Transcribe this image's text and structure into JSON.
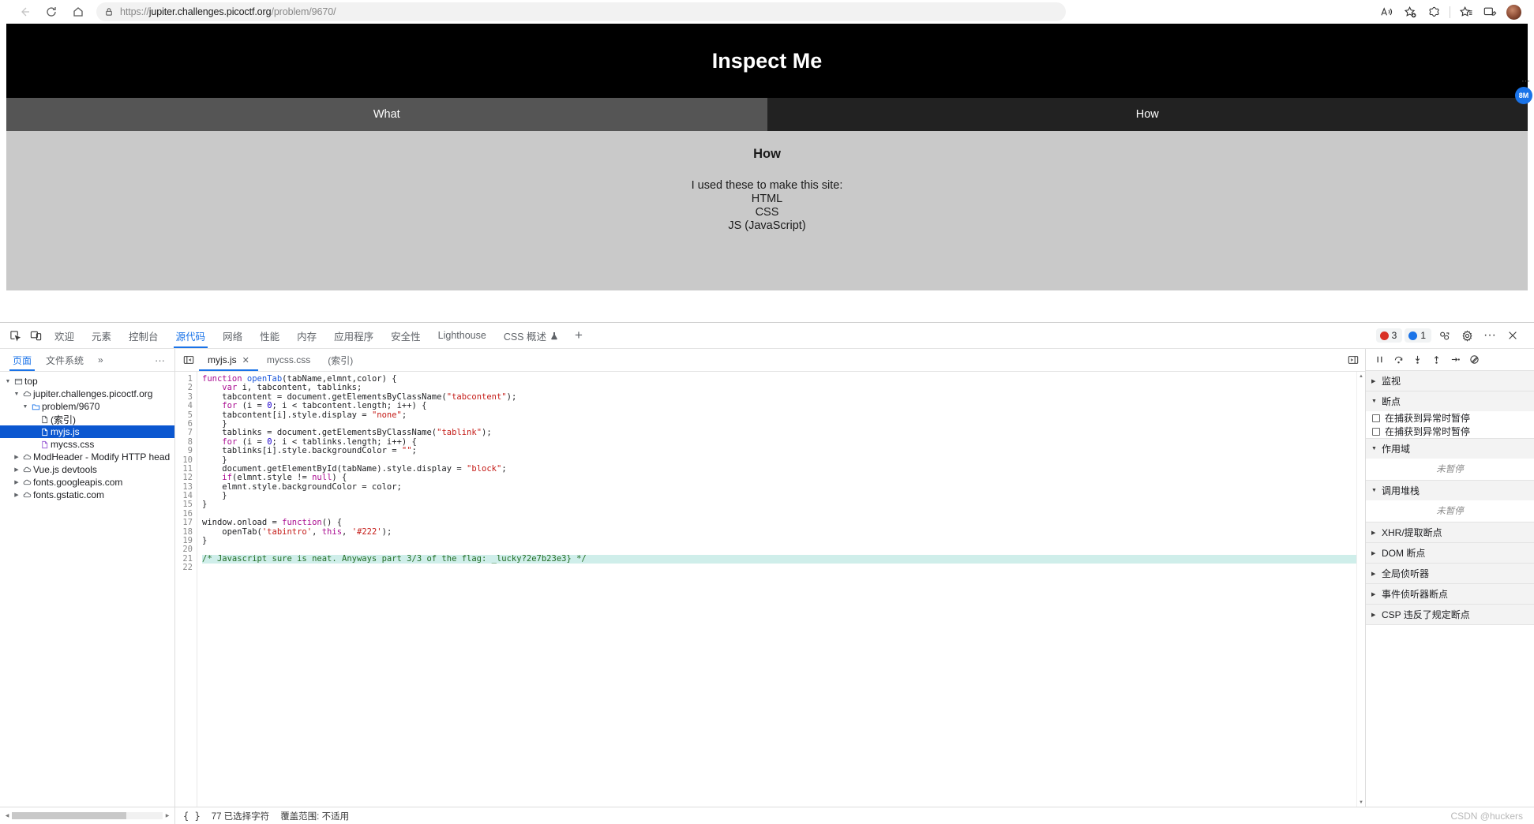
{
  "browser": {
    "back_label": "back-arrow",
    "reload_label": "reload",
    "home_label": "home",
    "url_scheme": "https://",
    "url_host": "jupiter.challenges.picoctf.org",
    "url_path": "/problem/9670/",
    "lock_icon": "lock-icon",
    "read_aloud_icon": "read-aloud-icon",
    "favorites_icon": "add-favorite-icon",
    "collections_icon": "collections-icon",
    "split_screen_icon": "split-screen-icon",
    "browser_essentials_icon": "browser-essentials-icon",
    "profile_icon": "profile-avatar"
  },
  "webpage": {
    "title": "Inspect Me",
    "tabs": [
      {
        "label": "What",
        "active": false
      },
      {
        "label": "How",
        "active": true
      }
    ],
    "heading": "How",
    "lines": [
      "I used these to make this site:",
      "HTML",
      "CSS",
      "JS (JavaScript)"
    ],
    "badge": "8M"
  },
  "devtools": {
    "panel_tabs": [
      {
        "label": "欢迎",
        "active": false
      },
      {
        "label": "元素",
        "active": false
      },
      {
        "label": "控制台",
        "active": false
      },
      {
        "label": "源代码",
        "active": true
      },
      {
        "label": "网络",
        "active": false
      },
      {
        "label": "性能",
        "active": false
      },
      {
        "label": "内存",
        "active": false
      },
      {
        "label": "应用程序",
        "active": false
      },
      {
        "label": "安全性",
        "active": false
      },
      {
        "label": "Lighthouse",
        "active": false
      },
      {
        "label": "CSS 概述",
        "active": false
      }
    ],
    "add_tab_label": "+",
    "error_count": "3",
    "message_count": "1",
    "navigator": {
      "tabs": [
        {
          "label": "页面",
          "active": true
        },
        {
          "label": "文件系统",
          "active": false
        }
      ],
      "more_tabs": "»",
      "more_menu": "···",
      "tree": [
        {
          "indent": 0,
          "twisty": "▼",
          "icon": "frame",
          "label": "top",
          "selected": false
        },
        {
          "indent": 1,
          "twisty": "▼",
          "icon": "cloud",
          "label": "jupiter.challenges.picoctf.org",
          "selected": false
        },
        {
          "indent": 2,
          "twisty": "▼",
          "icon": "folder",
          "label": "problem/9670",
          "selected": false
        },
        {
          "indent": 3,
          "twisty": "",
          "icon": "doc",
          "label": "(索引)",
          "selected": false
        },
        {
          "indent": 3,
          "twisty": "",
          "icon": "doc-js",
          "label": "myjs.js",
          "selected": true
        },
        {
          "indent": 3,
          "twisty": "",
          "icon": "doc-css",
          "label": "mycss.css",
          "selected": false
        },
        {
          "indent": 1,
          "twisty": "▶",
          "icon": "cloud",
          "label": "ModHeader - Modify HTTP head",
          "selected": false
        },
        {
          "indent": 1,
          "twisty": "▶",
          "icon": "cloud",
          "label": "Vue.js devtools",
          "selected": false
        },
        {
          "indent": 1,
          "twisty": "▶",
          "icon": "cloud",
          "label": "fonts.googleapis.com",
          "selected": false
        },
        {
          "indent": 1,
          "twisty": "▶",
          "icon": "cloud",
          "label": "fonts.gstatic.com",
          "selected": false
        }
      ]
    },
    "editor": {
      "tabs": [
        {
          "label": "myjs.js",
          "active": true,
          "closable": true
        },
        {
          "label": "mycss.css",
          "active": false,
          "closable": false
        },
        {
          "label": "(索引)",
          "active": false,
          "closable": false
        }
      ],
      "code_lines": [
        {
          "n": 1,
          "highlight": false,
          "tokens": [
            {
              "t": "function ",
              "c": "kw"
            },
            {
              "t": "openTab",
              "c": "fn"
            },
            {
              "t": "(tabName,elmnt,color) {",
              "c": "pln"
            }
          ]
        },
        {
          "n": 2,
          "highlight": false,
          "tokens": [
            {
              "t": "    ",
              "c": "pln"
            },
            {
              "t": "var",
              "c": "kw"
            },
            {
              "t": " i, tabcontent, tablinks;",
              "c": "pln"
            }
          ]
        },
        {
          "n": 3,
          "highlight": false,
          "tokens": [
            {
              "t": "    tabcontent = document.getElementsByClassName(",
              "c": "pln"
            },
            {
              "t": "\"tabcontent\"",
              "c": "str"
            },
            {
              "t": ");",
              "c": "pln"
            }
          ]
        },
        {
          "n": 4,
          "highlight": false,
          "tokens": [
            {
              "t": "    ",
              "c": "pln"
            },
            {
              "t": "for",
              "c": "kw"
            },
            {
              "t": " (i = ",
              "c": "pln"
            },
            {
              "t": "0",
              "c": "num"
            },
            {
              "t": "; i < tabcontent.length; i++) {",
              "c": "pln"
            }
          ]
        },
        {
          "n": 5,
          "highlight": false,
          "tokens": [
            {
              "t": "    tabcontent[i].style.display = ",
              "c": "pln"
            },
            {
              "t": "\"none\"",
              "c": "str"
            },
            {
              "t": ";",
              "c": "pln"
            }
          ]
        },
        {
          "n": 6,
          "highlight": false,
          "tokens": [
            {
              "t": "    }",
              "c": "pln"
            }
          ]
        },
        {
          "n": 7,
          "highlight": false,
          "tokens": [
            {
              "t": "    tablinks = document.getElementsByClassName(",
              "c": "pln"
            },
            {
              "t": "\"tablink\"",
              "c": "str"
            },
            {
              "t": ");",
              "c": "pln"
            }
          ]
        },
        {
          "n": 8,
          "highlight": false,
          "tokens": [
            {
              "t": "    ",
              "c": "pln"
            },
            {
              "t": "for",
              "c": "kw"
            },
            {
              "t": " (i = ",
              "c": "pln"
            },
            {
              "t": "0",
              "c": "num"
            },
            {
              "t": "; i < tablinks.length; i++) {",
              "c": "pln"
            }
          ]
        },
        {
          "n": 9,
          "highlight": false,
          "tokens": [
            {
              "t": "    tablinks[i].style.backgroundColor = ",
              "c": "pln"
            },
            {
              "t": "\"\"",
              "c": "str"
            },
            {
              "t": ";",
              "c": "pln"
            }
          ]
        },
        {
          "n": 10,
          "highlight": false,
          "tokens": [
            {
              "t": "    }",
              "c": "pln"
            }
          ]
        },
        {
          "n": 11,
          "highlight": false,
          "tokens": [
            {
              "t": "    document.getElementById(tabName).style.display = ",
              "c": "pln"
            },
            {
              "t": "\"block\"",
              "c": "str"
            },
            {
              "t": ";",
              "c": "pln"
            }
          ]
        },
        {
          "n": 12,
          "highlight": false,
          "tokens": [
            {
              "t": "    ",
              "c": "pln"
            },
            {
              "t": "if",
              "c": "kw"
            },
            {
              "t": "(elmnt.style != ",
              "c": "pln"
            },
            {
              "t": "null",
              "c": "kw"
            },
            {
              "t": ") {",
              "c": "pln"
            }
          ]
        },
        {
          "n": 13,
          "highlight": false,
          "tokens": [
            {
              "t": "    elmnt.style.backgroundColor = color;",
              "c": "pln"
            }
          ]
        },
        {
          "n": 14,
          "highlight": false,
          "tokens": [
            {
              "t": "    }",
              "c": "pln"
            }
          ]
        },
        {
          "n": 15,
          "highlight": false,
          "tokens": [
            {
              "t": "}",
              "c": "pln"
            }
          ]
        },
        {
          "n": 16,
          "highlight": false,
          "tokens": [
            {
              "t": "",
              "c": "pln"
            }
          ]
        },
        {
          "n": 17,
          "highlight": false,
          "tokens": [
            {
              "t": "window.onload = ",
              "c": "pln"
            },
            {
              "t": "function",
              "c": "kw"
            },
            {
              "t": "() {",
              "c": "pln"
            }
          ]
        },
        {
          "n": 18,
          "highlight": false,
          "tokens": [
            {
              "t": "    openTab(",
              "c": "pln"
            },
            {
              "t": "'tabintro'",
              "c": "str"
            },
            {
              "t": ", ",
              "c": "pln"
            },
            {
              "t": "this",
              "c": "kw"
            },
            {
              "t": ", ",
              "c": "pln"
            },
            {
              "t": "'#222'",
              "c": "str"
            },
            {
              "t": ");",
              "c": "pln"
            }
          ]
        },
        {
          "n": 19,
          "highlight": false,
          "tokens": [
            {
              "t": "}",
              "c": "pln"
            }
          ]
        },
        {
          "n": 20,
          "highlight": false,
          "tokens": [
            {
              "t": "",
              "c": "pln"
            }
          ]
        },
        {
          "n": 21,
          "highlight": true,
          "tokens": [
            {
              "t": "/* Javascript sure is neat. Anyways part 3/3 of the flag: _lucky?2e7b23e3} */",
              "c": "cmt"
            }
          ]
        },
        {
          "n": 22,
          "highlight": false,
          "tokens": [
            {
              "t": "",
              "c": "pln"
            }
          ]
        }
      ]
    },
    "debugger": {
      "toolbar_icons": [
        "pause-resume-icon",
        "step-over-icon",
        "step-into-icon",
        "step-out-icon",
        "step-icon",
        "deactivate-breakpoints-icon"
      ],
      "sections": [
        {
          "title": "监视",
          "open": false,
          "kind": "empty",
          "body": ""
        },
        {
          "title": "断点",
          "open": true,
          "kind": "checkboxes",
          "items": [
            "在捕获到异常时暂停",
            "在捕获到异常时暂停"
          ]
        },
        {
          "title": "作用域",
          "open": true,
          "kind": "empty",
          "body": "未暂停"
        },
        {
          "title": "调用堆栈",
          "open": true,
          "kind": "empty",
          "body": "未暂停"
        },
        {
          "title": "XHR/提取断点",
          "open": false,
          "kind": "none",
          "body": ""
        },
        {
          "title": "DOM 断点",
          "open": false,
          "kind": "none",
          "body": ""
        },
        {
          "title": "全局侦听器",
          "open": false,
          "kind": "none",
          "body": ""
        },
        {
          "title": "事件侦听器断点",
          "open": false,
          "kind": "none",
          "body": ""
        },
        {
          "title": "CSP 违反了规定断点",
          "open": false,
          "kind": "none",
          "body": ""
        }
      ]
    },
    "status_bar": {
      "format_icon": "{ }",
      "selection": "77 已选择字符",
      "coverage": "覆盖范围: 不适用"
    }
  },
  "watermark": "CSDN @huckers",
  "colors": {
    "accent_blue": "#1a73e8",
    "selected_row": "#0b57d0",
    "error_red": "#d93025",
    "page_header_bg": "#000000",
    "tab_inactive_bg": "#555555",
    "tab_active_bg": "#222222",
    "page_content_bg": "#c9c9c9",
    "comment_green": "#236e25",
    "highlight_teal": "#cfeeea"
  }
}
